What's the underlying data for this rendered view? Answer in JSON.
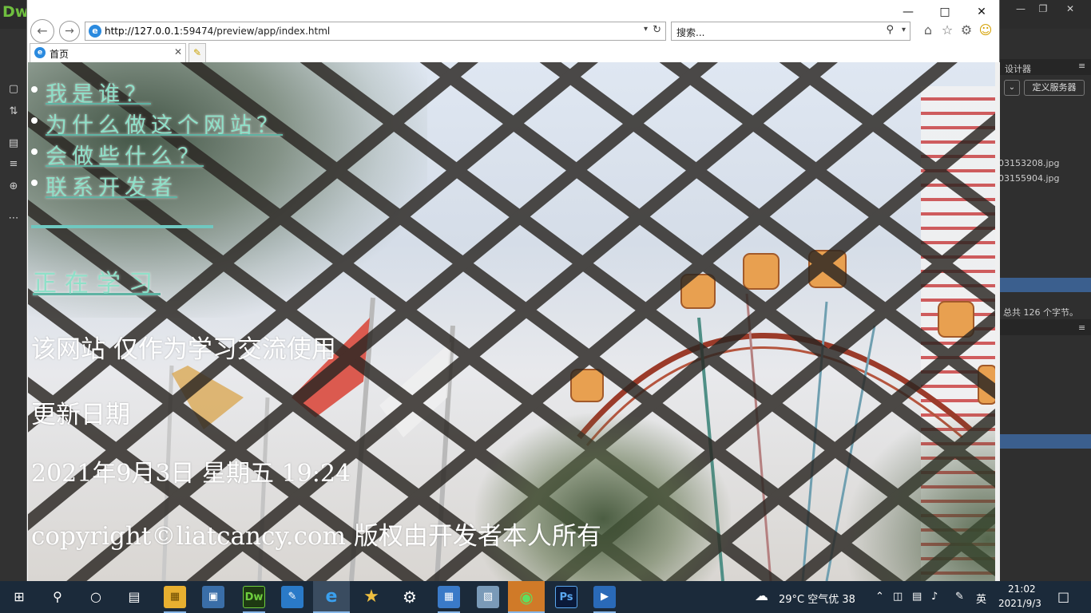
{
  "dreamweaver": {
    "logo": "Dw",
    "panel_title": "设计器",
    "server_button": "定义服务器",
    "files": [
      "03153208.jpg",
      "03155904.jpg"
    ],
    "char_count": "总共 126 个字节。"
  },
  "browser": {
    "url_host": "http://127.0.0.1",
    "url_rest": ":59474/preview/app/index.html",
    "search_placeholder": "搜索...",
    "tab_title": "首页"
  },
  "page": {
    "nav_items": [
      "我是谁？",
      "为什么做这个网站？",
      "会做些什么？",
      "联系开发者"
    ],
    "heading": "正在学习",
    "notice": "该网站 仅作为学习交流使用",
    "update_label": "更新日期",
    "update_value": "2021年9月3日 星期五 19:24",
    "copyright": "copyright©liatcancy.com 版权由开发者本人所有"
  },
  "taskbar": {
    "weather": "29°C 空气优 38",
    "ime": "英",
    "time": "21:02",
    "date": "2021/9/3"
  }
}
